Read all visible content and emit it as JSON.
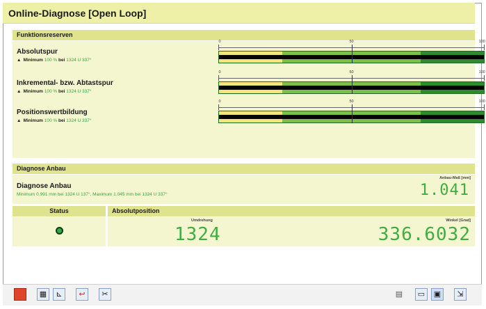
{
  "window": {
    "title": "Online-Diagnose [Open Loop]"
  },
  "reserves": {
    "section_title": "Funktionsreserven",
    "scale": {
      "min_label": "0",
      "mid_label": "50",
      "max_label": "100"
    },
    "rows": [
      {
        "title": "Absolutspur",
        "sub_prefix": "Minimum",
        "sub_value": "100 %",
        "sub_mid": "bei",
        "sub_pos": "1324 U 337°",
        "light_fraction": 0.76,
        "yellow_fraction": 0.24
      },
      {
        "title": "Inkremental- bzw. Abtastspur",
        "sub_prefix": "Minimum",
        "sub_value": "100 %",
        "sub_mid": "bei",
        "sub_pos": "1324 U 337°",
        "light_fraction": 0.76,
        "yellow_fraction": 0.24
      },
      {
        "title": "Positionswertbildung",
        "sub_prefix": "Minimum",
        "sub_value": "100 %",
        "sub_mid": "bei",
        "sub_pos": "1324 U 337°",
        "light_fraction": 0.76,
        "yellow_fraction": 0.24
      }
    ]
  },
  "anbau": {
    "section_title": "Diagnose Anbau",
    "row_title": "Diagnose Anbau",
    "sub_text": "Minimum 0.991 mm bei 1324 U 137°, Maximum 1.045 mm bei 1324 U 337°",
    "measure_label": "Anbau-Maß [mm]",
    "measure_value": "1.041"
  },
  "status": {
    "status_header": "Status",
    "abs_header": "Absolutposition",
    "turns_label": "Umdrehung",
    "turns_value": "1324",
    "angle_label": "Winkel [Grad]",
    "angle_value": "336.6032",
    "led_color": "#2fa84a"
  },
  "toolbar": {
    "left": [
      {
        "name": "stop-icon",
        "glyph": "■"
      },
      {
        "name": "grid-icon",
        "glyph": "▦"
      },
      {
        "name": "chart-icon",
        "glyph": "📈"
      },
      {
        "name": "undo-icon",
        "glyph": "↩"
      },
      {
        "name": "tools-icon",
        "glyph": "✂"
      }
    ],
    "right": [
      {
        "name": "save-icon",
        "glyph": "💾"
      },
      {
        "name": "window-icon",
        "glyph": "▭"
      },
      {
        "name": "split-view-icon",
        "glyph": "▣"
      },
      {
        "name": "export-icon",
        "glyph": "⇲"
      }
    ]
  }
}
